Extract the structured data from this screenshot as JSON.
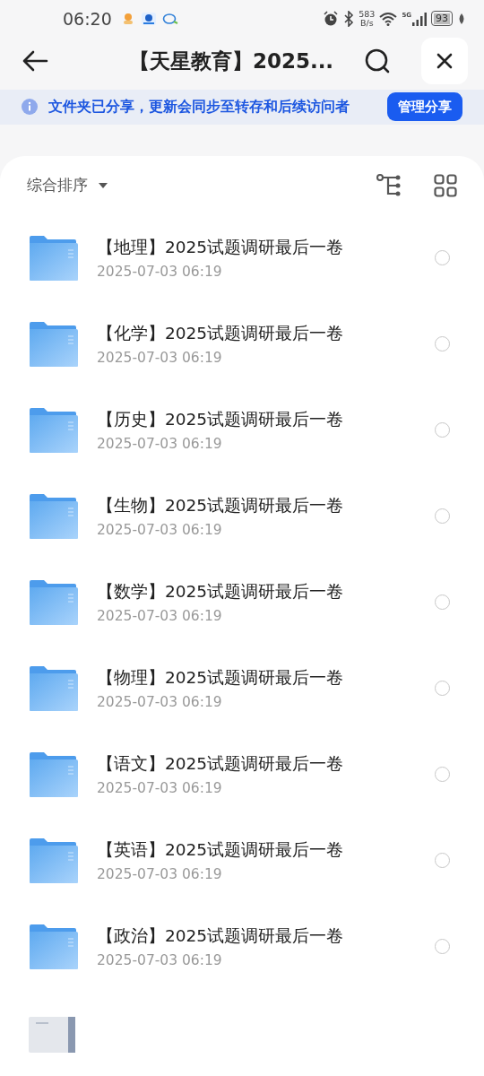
{
  "status_bar": {
    "time": "06:20",
    "net_speed": "583",
    "net_unit": "B/s",
    "network": "5G",
    "battery": "93"
  },
  "header": {
    "title": "【天星教育】2025..."
  },
  "share_banner": {
    "message": "文件夹已分享，更新会同步至转存和后续访问者",
    "button": "管理分享"
  },
  "toolbar": {
    "sort": "综合排序"
  },
  "files": [
    {
      "kind": "folder",
      "name": "【地理】2025试题调研最后一卷",
      "date": "2025-07-03 06:19",
      "selected": false
    },
    {
      "kind": "folder",
      "name": "【化学】2025试题调研最后一卷",
      "date": "2025-07-03 06:19",
      "selected": false
    },
    {
      "kind": "folder",
      "name": "【历史】2025试题调研最后一卷",
      "date": "2025-07-03 06:19",
      "selected": false
    },
    {
      "kind": "folder",
      "name": "【生物】2025试题调研最后一卷",
      "date": "2025-07-03 06:19",
      "selected": false
    },
    {
      "kind": "folder",
      "name": "【数学】2025试题调研最后一卷",
      "date": "2025-07-03 06:19",
      "selected": false
    },
    {
      "kind": "folder",
      "name": "【物理】2025试题调研最后一卷",
      "date": "2025-07-03 06:19",
      "selected": false
    },
    {
      "kind": "folder",
      "name": "【语文】2025试题调研最后一卷",
      "date": "2025-07-03 06:19",
      "selected": false
    },
    {
      "kind": "folder",
      "name": "【英语】2025试题调研最后一卷",
      "date": "2025-07-03 06:19",
      "selected": false
    },
    {
      "kind": "folder",
      "name": "【政治】2025试题调研最后一卷",
      "date": "2025-07-03 06:19",
      "selected": false
    },
    {
      "kind": "document"
    }
  ]
}
